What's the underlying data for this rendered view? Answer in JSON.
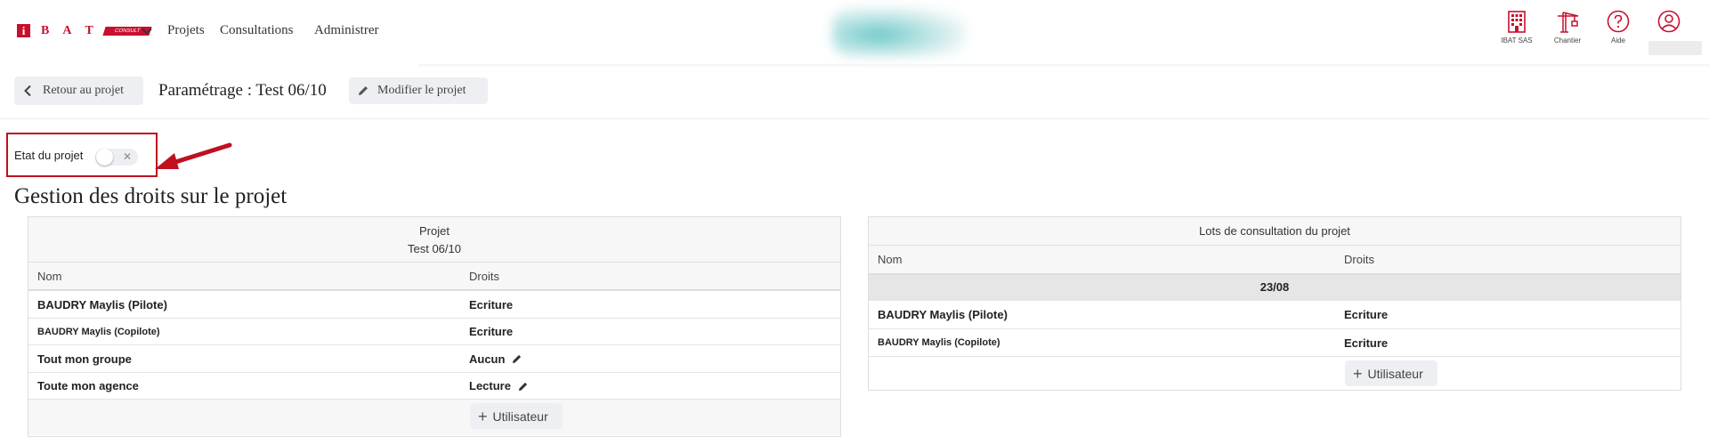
{
  "brand": {
    "logo_letters": [
      "B",
      "A",
      "T"
    ],
    "logo_i": "i",
    "logo_badge": "CONSULT",
    "color": "#c8102e"
  },
  "nav": {
    "links": [
      "Projets",
      "Consultations",
      "Administrer"
    ]
  },
  "header_icons": [
    {
      "icon": "building-icon",
      "caption": "IBAT SAS"
    },
    {
      "icon": "crane-icon",
      "caption": "Chantier"
    },
    {
      "icon": "help-icon",
      "caption": "Aide"
    },
    {
      "icon": "user-icon",
      "caption": ""
    }
  ],
  "subheader": {
    "back_label": "Retour au projet",
    "title": "Paramétrage : Test 06/10",
    "edit_label": "Modifier le projet"
  },
  "etat": {
    "label": "Etat du projet",
    "toggle_state": "off",
    "toggle_off_glyph": "✕"
  },
  "section_title": "Gestion des droits sur le projet",
  "projet_table": {
    "caption_line1": "Projet",
    "caption_line2": "Test 06/10",
    "columns": [
      "Nom",
      "Droits"
    ],
    "rows": [
      {
        "nom": "BAUDRY Maylis (Pilote)",
        "droits": "Ecriture",
        "editable": false
      },
      {
        "nom": "BAUDRY Maylis (Copilote)",
        "droits": "Ecriture",
        "editable": false
      },
      {
        "nom": "Tout mon groupe",
        "droits": "Aucun",
        "editable": true
      },
      {
        "nom": "Toute mon agence",
        "droits": "Lecture",
        "editable": true
      }
    ],
    "add_label": "Utilisateur"
  },
  "lots_table": {
    "caption": "Lots de consultation du projet",
    "columns": [
      "Nom",
      "Droits"
    ],
    "group": "23/08",
    "rows": [
      {
        "nom": "BAUDRY Maylis (Pilote)",
        "droits": "Ecriture"
      },
      {
        "nom": "BAUDRY Maylis (Copilote)",
        "droits": "Ecriture"
      }
    ],
    "add_label": "Utilisateur"
  }
}
